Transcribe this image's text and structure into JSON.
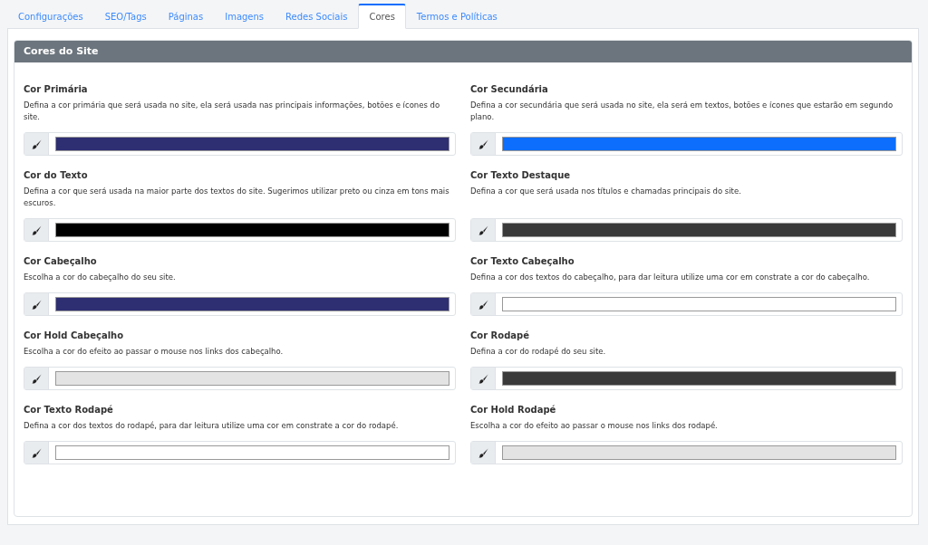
{
  "tabs": [
    {
      "label": "Configurações",
      "selected": false
    },
    {
      "label": "SEO/Tags",
      "selected": false
    },
    {
      "label": "Páginas",
      "selected": false
    },
    {
      "label": "Imagens",
      "selected": false
    },
    {
      "label": "Redes Sociais",
      "selected": false
    },
    {
      "label": "Cores",
      "selected": true
    },
    {
      "label": "Termos e Políticas",
      "selected": false
    }
  ],
  "panel": {
    "title": "Cores do Site",
    "fields": [
      {
        "label": "Cor Primária",
        "description": "Defina a cor primária que será usada no site, ela será usada nas principais informações, botões e ícones do site.",
        "color": "#2e2e73"
      },
      {
        "label": "Cor Secundária",
        "description": "Defina a cor secundária que será usada no site, ela será em textos, botões e ícones que estarão em segundo plano.",
        "color": "#0d6efd"
      },
      {
        "label": "Cor do Texto",
        "description": "Defina a cor que será usada na maior parte dos textos do site. Sugerimos utilizar preto ou cinza em tons mais escuros.",
        "color": "#000000"
      },
      {
        "label": "Cor Texto Destaque",
        "description": "Defina a cor que será usada nos títulos e chamadas principais do site.",
        "color": "#3a3a3a"
      },
      {
        "label": "Cor Cabeçalho",
        "description": "Escolha a cor do cabeçalho do seu site.",
        "color": "#2e2e73"
      },
      {
        "label": "Cor Texto Cabeçalho",
        "description": "Defina a cor dos textos do cabeçalho, para dar leitura utilize uma cor em constrate a cor do cabeçalho.",
        "color": "#ffffff"
      },
      {
        "label": "Cor Hold Cabeçalho",
        "description": "Escolha a cor do efeito ao passar o mouse nos links dos cabeçalho.",
        "color": "#e3e3e3"
      },
      {
        "label": "Cor Rodapé",
        "description": "Defina a cor do rodapé do seu site.",
        "color": "#3a3a3a"
      },
      {
        "label": "Cor Texto Rodapé",
        "description": "Defina a cor dos textos do rodapé, para dar leitura utilize uma cor em constrate a cor do rodapé.",
        "color": "#ffffff"
      },
      {
        "label": "Cor Hold Rodapé",
        "description": "Escolha a cor do efeito ao passar o mouse nos links dos rodapé.",
        "color": "#e3e3e3"
      }
    ]
  }
}
